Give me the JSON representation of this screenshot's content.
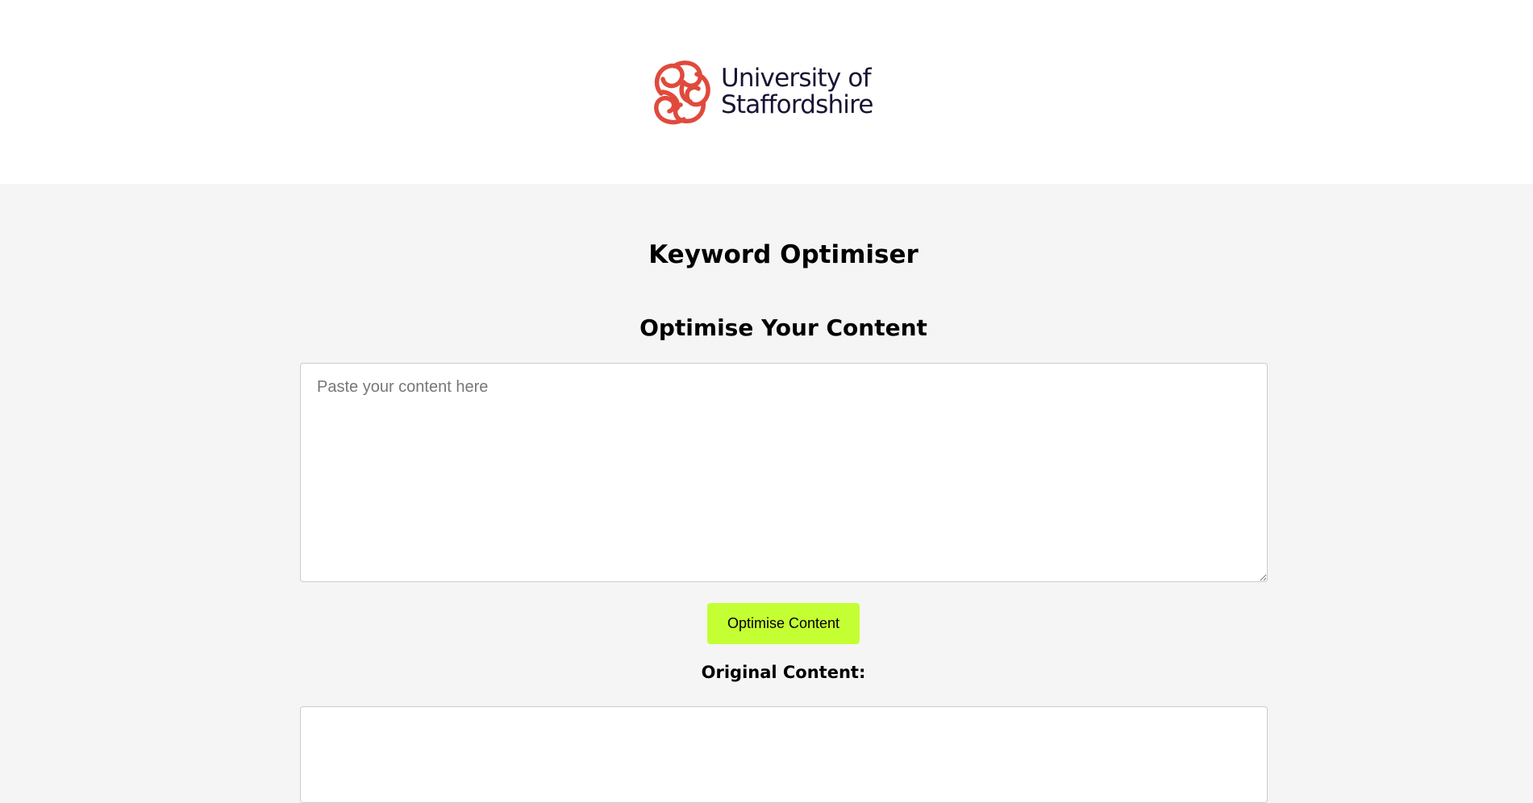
{
  "header": {
    "logo": {
      "line1": "University of",
      "line2": "Staffordshire",
      "mark_color": "#e04a3c",
      "text_color": "#1a1333"
    }
  },
  "main": {
    "title": "Keyword Optimiser",
    "section_title": "Optimise Your Content",
    "input": {
      "placeholder": "Paste your content here",
      "value": ""
    },
    "optimise_button_label": "Optimise Content",
    "original_content_label": "Original Content:",
    "accent_color": "#c4ff33",
    "background_color": "#f5f5f5"
  }
}
